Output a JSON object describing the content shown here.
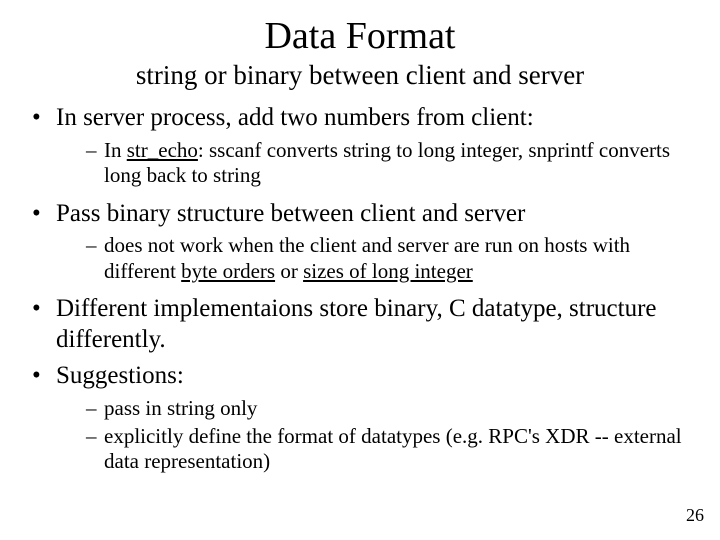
{
  "title": "Data Format",
  "subtitle": "string or binary between client and server",
  "b1": "In server process, add two numbers from client:",
  "b1s1a": "In ",
  "b1s1b": "str_echo",
  "b1s1c": ": sscanf converts string to long integer, snprintf converts long back to string",
  "b2": "Pass binary structure between client and server",
  "b2s1a": "does not work when the client and server are run on hosts with different ",
  "b2s1b": "byte orders",
  "b2s1c": " or ",
  "b2s1d": "sizes of long integer",
  "b3": "Different implementaions store binary, C datatype, structure differently.",
  "b4": "Suggestions:",
  "b4s1": "pass in string only",
  "b4s2": "explicitly define the format of datatypes (e.g. RPC's XDR -- external data representation)",
  "page": "26"
}
